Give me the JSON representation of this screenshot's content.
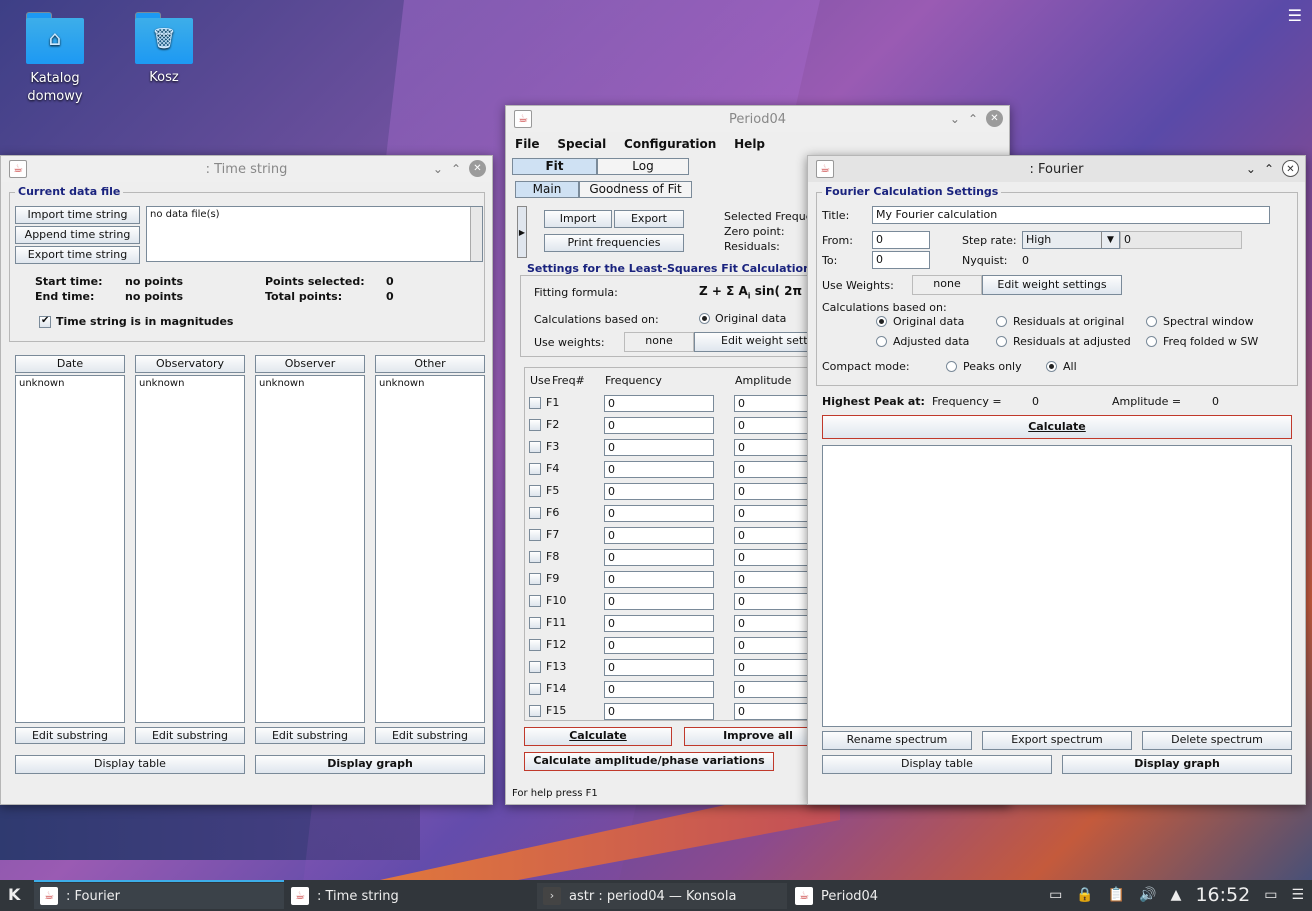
{
  "desktop": {
    "icons": [
      {
        "label": "Katalog\ndomowy",
        "glyph": "⌂"
      },
      {
        "label": "Kosz",
        "glyph": "🗑"
      }
    ]
  },
  "time_string": {
    "title": ": Time string",
    "group": "Current data file",
    "buttons": {
      "import": "Import time string",
      "append": "Append time string",
      "export": "Export time string"
    },
    "files_list": "no data file(s)",
    "start_label": "Start time:",
    "start_val": "no points",
    "end_label": "End time:",
    "end_val": "no points",
    "points_sel_label": "Points selected:",
    "points_sel_val": "0",
    "total_label": "Total points:",
    "total_val": "0",
    "magnitudes": "Time string is in magnitudes",
    "columns": [
      {
        "header": "Date",
        "item": "unknown"
      },
      {
        "header": "Observatory",
        "item": "unknown"
      },
      {
        "header": "Observer",
        "item": "unknown"
      },
      {
        "header": "Other",
        "item": "unknown"
      }
    ],
    "edit_sub": "Edit substring",
    "display_table": "Display table",
    "display_graph": "Display graph"
  },
  "period04": {
    "title": "Period04",
    "menu": [
      "File",
      "Special",
      "Configuration",
      "Help"
    ],
    "tabs": [
      "Fit",
      "Log"
    ],
    "subtabs": [
      "Main",
      "Goodness of Fit"
    ],
    "import": "Import",
    "export": "Export",
    "print": "Print frequencies",
    "selected_freq": "Selected Freque",
    "zero_point": "Zero point:",
    "residuals": "Residuals:",
    "ls_group": "Settings for the Least-Squares Fit Calculation",
    "fitting_label": "Fitting formula:",
    "formula": "Z + Σ A",
    "formula_sub": "i",
    "formula_rest": " sin( 2π",
    "calc_based": "Calculations based on:",
    "orig": "Original data",
    "use_weights": "Use weights:",
    "none": "none",
    "edit_weights": "Edit weight setti",
    "table_headers": {
      "use": "Use",
      "freq_num": "Freq#",
      "frequency": "Frequency",
      "amplitude": "Amplitude"
    },
    "rows": [
      {
        "name": "F1",
        "freq": "0",
        "amp": "0"
      },
      {
        "name": "F2",
        "freq": "0",
        "amp": "0"
      },
      {
        "name": "F3",
        "freq": "0",
        "amp": "0"
      },
      {
        "name": "F4",
        "freq": "0",
        "amp": "0"
      },
      {
        "name": "F5",
        "freq": "0",
        "amp": "0"
      },
      {
        "name": "F6",
        "freq": "0",
        "amp": "0"
      },
      {
        "name": "F7",
        "freq": "0",
        "amp": "0"
      },
      {
        "name": "F8",
        "freq": "0",
        "amp": "0"
      },
      {
        "name": "F9",
        "freq": "0",
        "amp": "0"
      },
      {
        "name": "F10",
        "freq": "0",
        "amp": "0"
      },
      {
        "name": "F11",
        "freq": "0",
        "amp": "0"
      },
      {
        "name": "F12",
        "freq": "0",
        "amp": "0"
      },
      {
        "name": "F13",
        "freq": "0",
        "amp": "0"
      },
      {
        "name": "F14",
        "freq": "0",
        "amp": "0"
      },
      {
        "name": "F15",
        "freq": "0",
        "amp": "0"
      }
    ],
    "calculate": "Calculate",
    "improve": "Improve all",
    "amp_phase": "Calculate amplitude/phase variations",
    "status": "For help press F1"
  },
  "fourier": {
    "title": ": Fourier",
    "group": "Fourier Calculation Settings",
    "title_label": "Title:",
    "title_val": "My Fourier calculation",
    "from_label": "From:",
    "from_val": "0",
    "to_label": "To:",
    "to_val": "0",
    "step_label": "Step rate:",
    "step_val": "High",
    "step_num": "0",
    "nyquist_label": "Nyquist:",
    "nyquist_val": "0",
    "use_weights": "Use Weights:",
    "none": "none",
    "edit_weights": "Edit weight settings",
    "calc_based": "Calculations based on:",
    "options": [
      "Original data",
      "Residuals at original",
      "Spectral window",
      "Adjusted data",
      "Residuals at adjusted",
      "Freq folded w SW"
    ],
    "compact": "Compact mode:",
    "peaks_only": "Peaks only",
    "all": "All",
    "highest": "Highest Peak at:",
    "freq_eq": "Frequency =",
    "freq_val": "0",
    "amp_eq": "Amplitude =",
    "amp_val": "0",
    "calculate": "Calculate",
    "rename": "Rename spectrum",
    "export": "Export spectrum",
    "delete": "Delete spectrum",
    "display_table": "Display table",
    "display_graph": "Display graph"
  },
  "taskbar": {
    "tasks": [
      ":  Fourier",
      ":  Time string",
      "astr : period04 — Konsola",
      "Period04"
    ],
    "clock": "16:52"
  }
}
